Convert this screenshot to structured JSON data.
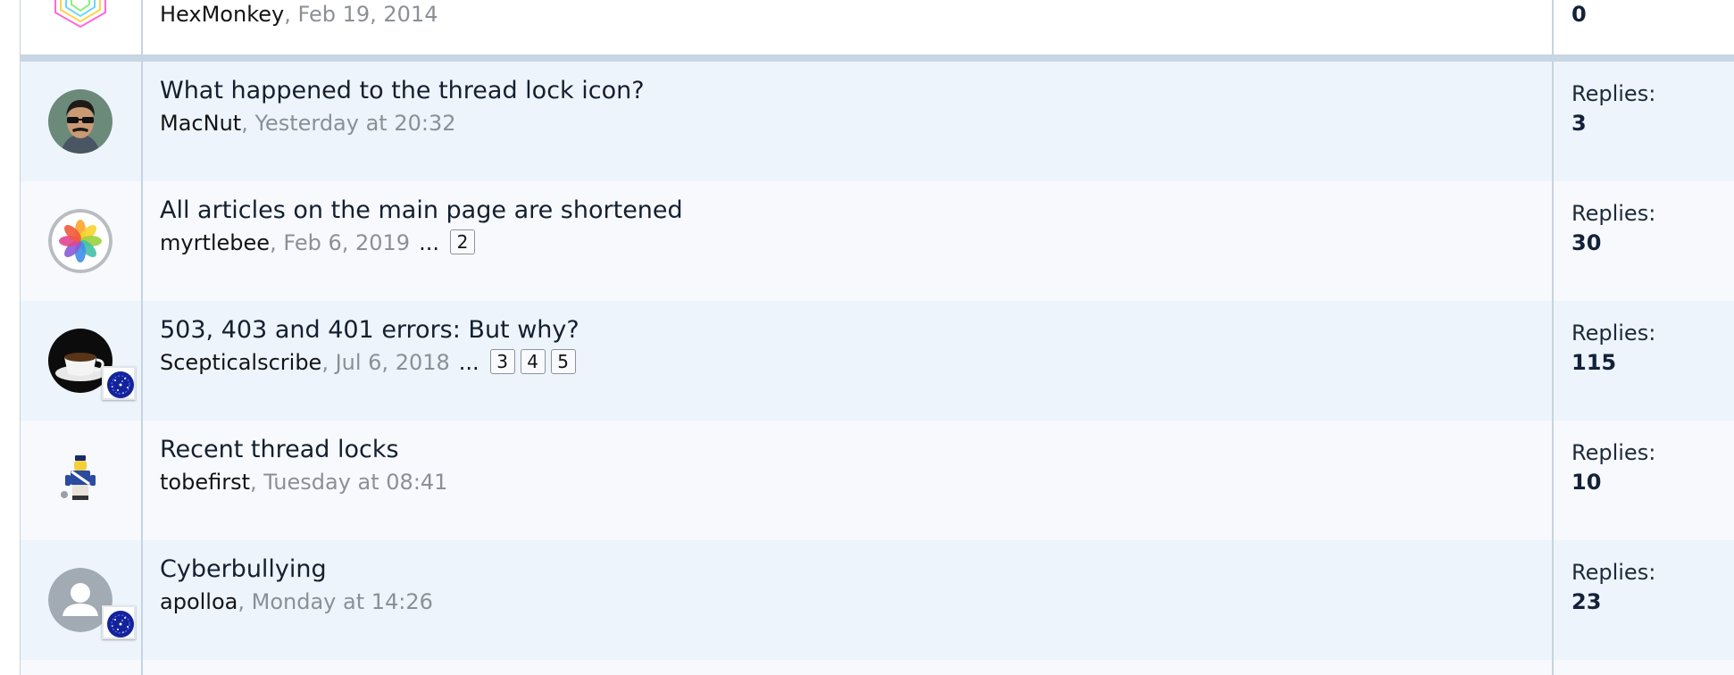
{
  "first_thread": {
    "author": "HexMonkey",
    "date": "Feb 19, 2014",
    "replies": "0",
    "avatar_icon": "colorful-hexagon-avatar-icon"
  },
  "threads": [
    {
      "title": "What happened to the thread lock icon?",
      "author": "MacNut",
      "date": "Yesterday at 20:32",
      "replies_label": "Replies:",
      "replies": "3",
      "avatar_icon": "man-sunglasses-avatar-icon"
    },
    {
      "title": "All articles on the main page are shortened",
      "author": "myrtlebee",
      "date": "Feb 6, 2019",
      "dots": "...",
      "pages": [
        "2"
      ],
      "replies_label": "Replies:",
      "replies": "30",
      "avatar_icon": "photos-app-avatar-icon"
    },
    {
      "title": "503, 403 and 401 errors: But why?",
      "author": "Scepticalscribe",
      "date": "Jul 6, 2018",
      "dots": "...",
      "pages": [
        "3",
        "4",
        "5"
      ],
      "replies_label": "Replies:",
      "replies": "115",
      "avatar_icon": "coffee-cup-avatar-icon",
      "mini_icon": "galaxy-mini-avatar-icon"
    },
    {
      "title": "Recent thread locks",
      "author": "tobefirst",
      "date": "Tuesday at 08:41",
      "replies_label": "Replies:",
      "replies": "10",
      "avatar_icon": "lego-figure-avatar-icon"
    },
    {
      "title": "Cyberbullying",
      "author": "apolloa",
      "date": "Monday at 14:26",
      "replies_label": "Replies:",
      "replies": "23",
      "avatar_icon": "default-user-avatar-icon",
      "mini_icon": "galaxy-mini-avatar-icon"
    }
  ],
  "colors": {
    "row_odd": "#edf4fc",
    "row_even": "#f7f9fd",
    "border": "#c7d3e0",
    "date_gray": "#8c9096"
  }
}
